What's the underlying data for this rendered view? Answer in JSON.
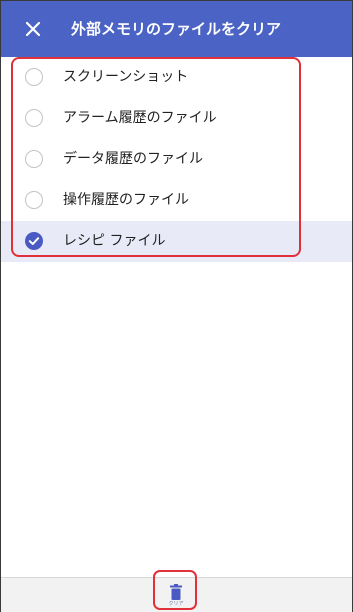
{
  "header": {
    "title": "外部メモリのファイルをクリア",
    "close_icon": "close-icon",
    "color": "#4a63c4"
  },
  "file_types": [
    {
      "label": "スクリーンショット",
      "checked": false
    },
    {
      "label": "アラーム履歴のファイル",
      "checked": false
    },
    {
      "label": "データ履歴のファイル",
      "checked": false
    },
    {
      "label": "操作履歴のファイル",
      "checked": false
    },
    {
      "label": "レシピ ファイル",
      "checked": true
    }
  ],
  "toolbar": {
    "clear_label": "クリア",
    "clear_icon": "trash-icon"
  },
  "colors": {
    "accent": "#4a5ac2",
    "highlight": "#e0303a",
    "selected_row": "#e8ebf7"
  }
}
